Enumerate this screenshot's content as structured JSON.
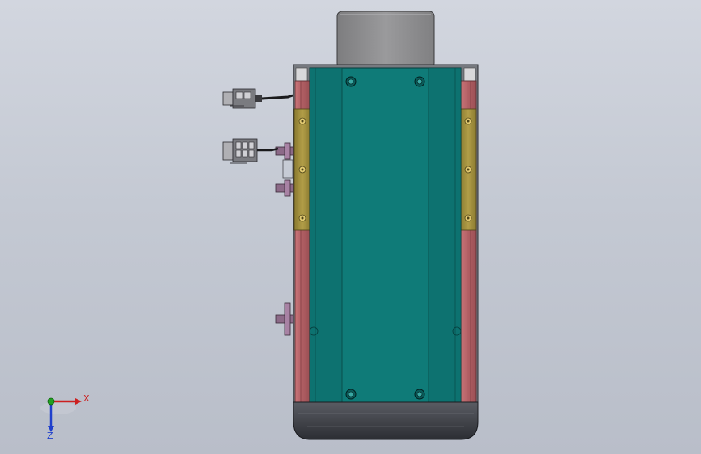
{
  "viewport": {
    "background_top": "#d2d6df",
    "background_bottom": "#b9bec9"
  },
  "colors": {
    "carriage": "#0f7b78",
    "carriage_dark": "#0a5b59",
    "rail": "#b8666b",
    "guide_strip": "#9c8a3a",
    "motor_cover": "#8f8f8f",
    "end_cap": "#3c3e45",
    "connector": "#6e6f74",
    "limit_sensor": "#8c6a88",
    "axis_x": "#cc2020",
    "axis_y": "#20a020",
    "axis_z": "#2040cc"
  },
  "triad": {
    "x_label": "X",
    "z_label": "Z"
  }
}
